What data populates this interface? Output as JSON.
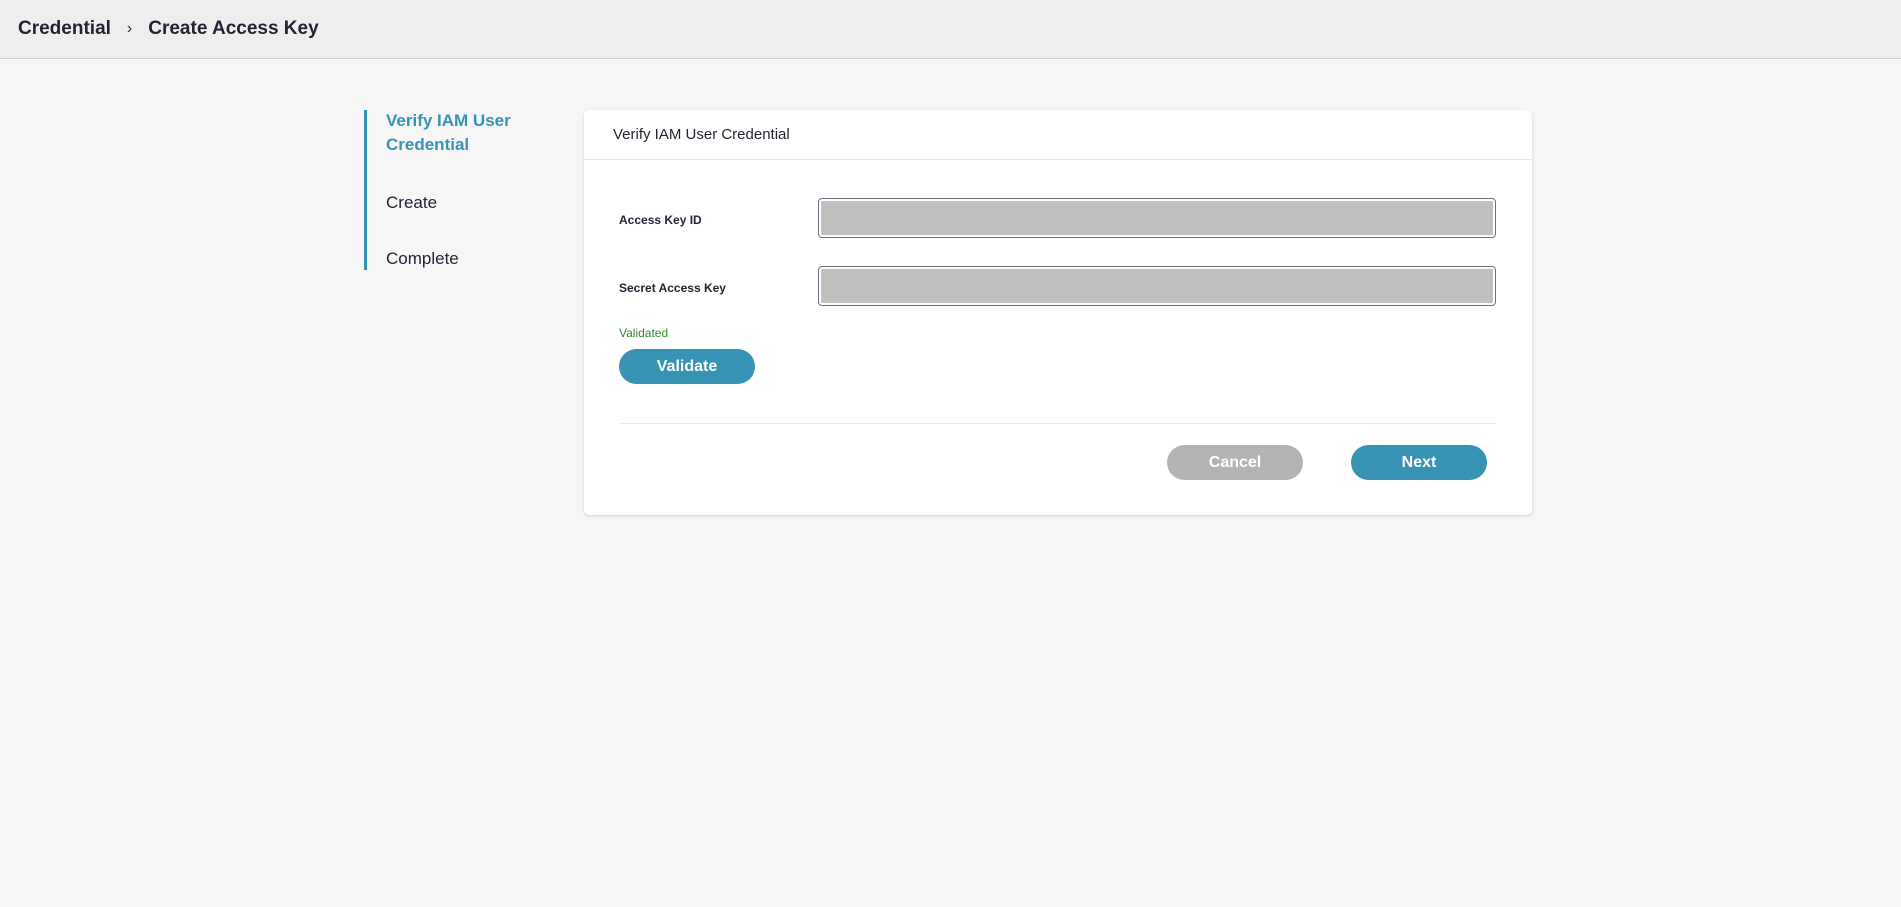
{
  "breadcrumb": {
    "parent": "Credential",
    "separator": "›",
    "current": "Create Access Key"
  },
  "stepper": {
    "steps": [
      {
        "label": "Verify IAM User Credential",
        "active": true
      },
      {
        "label": "Create"
      },
      {
        "label": "Complete"
      }
    ]
  },
  "card": {
    "title": "Verify IAM User Credential",
    "fields": [
      {
        "label": "Access Key ID",
        "value": ""
      },
      {
        "label": "Secret Access Key",
        "value": ""
      }
    ],
    "status": "Validated",
    "validate_label": "Validate",
    "cancel_label": "Cancel",
    "next_label": "Next"
  },
  "colors": {
    "accent": "#3793b3",
    "success": "#2e8b2e",
    "disabled": "#b3b3b3"
  }
}
